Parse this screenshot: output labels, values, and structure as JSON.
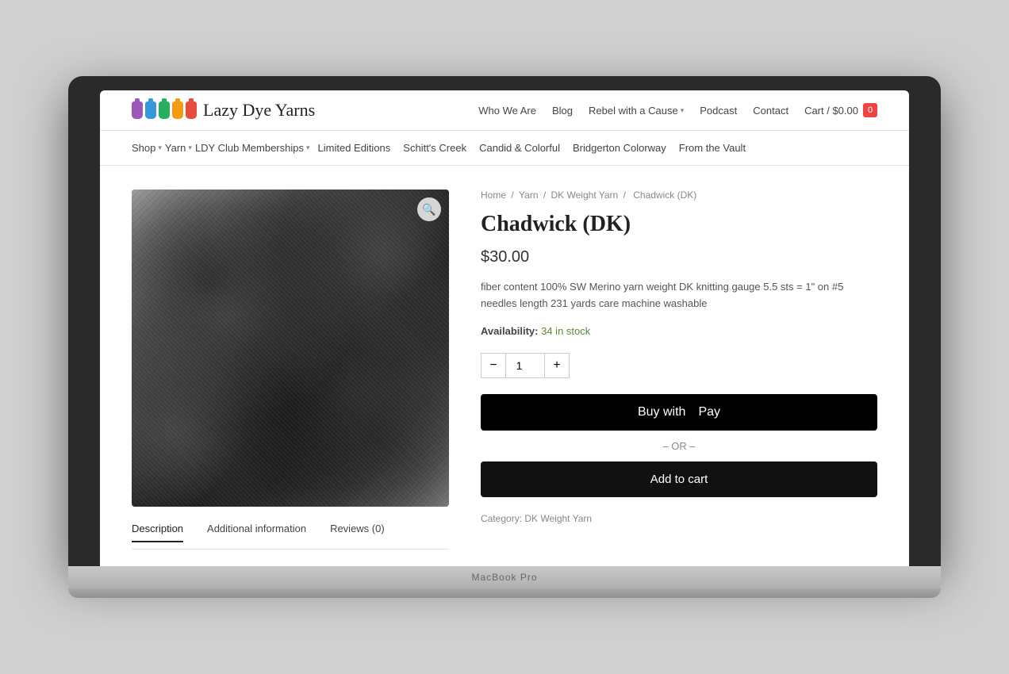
{
  "laptop": {
    "model": "MacBook Pro"
  },
  "header": {
    "logo_text": "Lazy Dye Yarns",
    "nav_items": [
      {
        "label": "Who We Are",
        "has_dropdown": false
      },
      {
        "label": "Blog",
        "has_dropdown": false
      },
      {
        "label": "Rebel with a Cause",
        "has_dropdown": true
      },
      {
        "label": "Podcast",
        "has_dropdown": false
      },
      {
        "label": "Contact",
        "has_dropdown": false
      }
    ],
    "cart_label": "Cart / $0.00",
    "cart_count": "0"
  },
  "secondary_nav": [
    {
      "label": "Shop",
      "has_dropdown": true
    },
    {
      "label": "Yarn",
      "has_dropdown": true
    },
    {
      "label": "LDY Club Memberships",
      "has_dropdown": true
    },
    {
      "label": "Limited Editions",
      "has_dropdown": false
    },
    {
      "label": "Schitt's Creek",
      "has_dropdown": false
    },
    {
      "label": "Candid & Colorful",
      "has_dropdown": false
    },
    {
      "label": "Bridgerton Colorway",
      "has_dropdown": false
    },
    {
      "label": "From the Vault",
      "has_dropdown": false
    }
  ],
  "breadcrumb": {
    "items": [
      "Home",
      "Yarn",
      "DK Weight Yarn",
      "Chadwick (DK)"
    ]
  },
  "product": {
    "title": "Chadwick (DK)",
    "price": "$30.00",
    "description": "fiber content 100% SW Merino yarn weight DK knitting gauge 5.5 sts = 1\" on #5 needles length 231 yards care machine washable",
    "availability_label": "Availability:",
    "availability_count": "34 in stock",
    "quantity": "1",
    "buy_apple_pay_label": "Buy with  Pay",
    "or_label": "– OR –",
    "add_to_cart_label": "Add to cart",
    "category_label": "Category:",
    "category_value": "DK Weight Yarn"
  },
  "tabs": [
    {
      "label": "Description",
      "active": true
    },
    {
      "label": "Additional information",
      "active": false
    },
    {
      "label": "Reviews (0)",
      "active": false
    }
  ],
  "qty_minus": "−",
  "qty_plus": "+"
}
